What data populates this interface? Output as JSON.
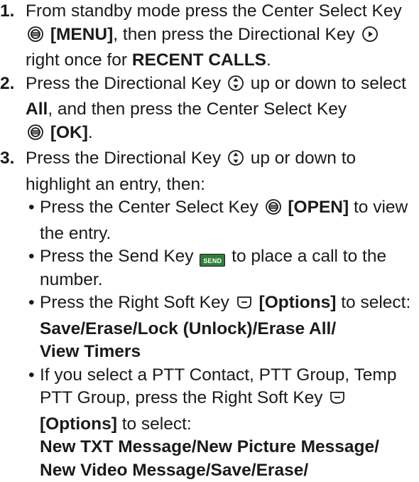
{
  "steps": [
    {
      "number": "1.",
      "t1": "From standby mode press the Center Select Key",
      "t2": "[MENU]",
      "t3": ", then press the Directional Key",
      "t4": "right once for",
      "t5": "RECENT CALLS",
      "t6": "."
    },
    {
      "number": "2.",
      "t1": "Press the Directional Key",
      "t2": "up or down to select",
      "t3": "All",
      "t4": ", and then press the Center Select Key",
      "t5": "[OK]",
      "t6": "."
    },
    {
      "number": "3.",
      "t1": "Press the Directional Key",
      "t2": "up or down to highlight an entry, then:"
    }
  ],
  "bullets": [
    {
      "dot": "•",
      "t1": "Press the Center Select Key",
      "t2": "[OPEN]",
      "t3": "to view the entry."
    },
    {
      "dot": "•",
      "t1": "Press the Send Key",
      "key_label": "SEND",
      "t2": "to place a call to the number."
    },
    {
      "dot": "•",
      "t1": "Press the Right Soft Key",
      "t2": "[Options]",
      "t3": "to select:",
      "bold1": "Save/Erase/Lock (Unlock)/Erase All/",
      "bold2": "View Timers"
    },
    {
      "dot": "•",
      "t1": "If you select a PTT Contact, PTT Group, Temp PTT Group, press the Right Soft Key",
      "t2": "[Options]",
      "t3": "to select:",
      "bold1": "New TXT Message/New Picture Message/",
      "bold2": "New Video Message/Save/Erase/"
    }
  ],
  "icons": {
    "center_select": "center-select-key-icon",
    "directional_right": "directional-right-icon",
    "directional_updown": "directional-updown-icon",
    "right_soft": "right-soft-key-icon",
    "send_key": "send-key-icon"
  },
  "colors": {
    "text": "#1a1a1a",
    "send_key_fill": "#2f7d3a"
  }
}
